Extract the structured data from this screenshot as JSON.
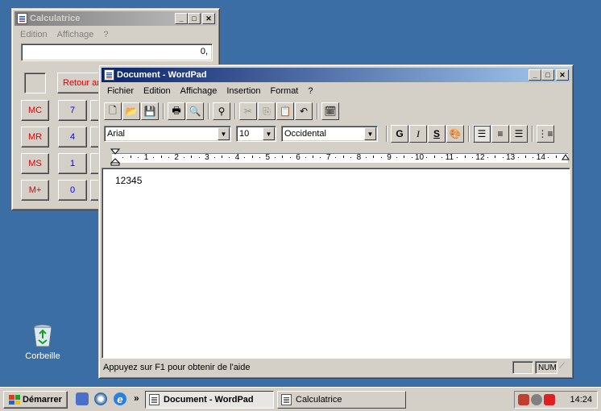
{
  "calculator": {
    "title": "Calculatrice",
    "menu": [
      "Edition",
      "Affichage",
      "?"
    ],
    "display": "0,",
    "backspace_label": "Retour ar",
    "memory_buttons": [
      "MC",
      "MR",
      "MS",
      "M+"
    ],
    "digit_buttons": [
      "7",
      "4",
      "1",
      "0"
    ]
  },
  "wordpad": {
    "title": "Document - WordPad",
    "menu": [
      "Fichier",
      "Edition",
      "Affichage",
      "Insertion",
      "Format",
      "?"
    ],
    "font_name": "Arial",
    "font_size": "10",
    "script": "Occidental",
    "bold_label": "G",
    "italic_label": "I",
    "underline_label": "S",
    "ruler_numbers": [
      "1",
      "2",
      "3",
      "4",
      "5",
      "6",
      "7",
      "8",
      "9",
      "10",
      "11",
      "12",
      "13",
      "14"
    ],
    "document_text": "12345",
    "status_text": "Appuyez sur F1 pour obtenir de l'aide",
    "status_num": "NUM"
  },
  "desktop": {
    "recycle_bin_label": "Corbeille"
  },
  "taskbar": {
    "start_label": "Démarrer",
    "overflow_label": "»",
    "tasks": [
      "Document - WordPad",
      "Calculatrice"
    ],
    "clock": "14:24"
  },
  "colors": {
    "desktop": "#3a6ea5",
    "active_title": "#0a246a",
    "inactive_title": "#808080",
    "calc_red": "#e00000",
    "calc_blue": "#0000ff"
  }
}
